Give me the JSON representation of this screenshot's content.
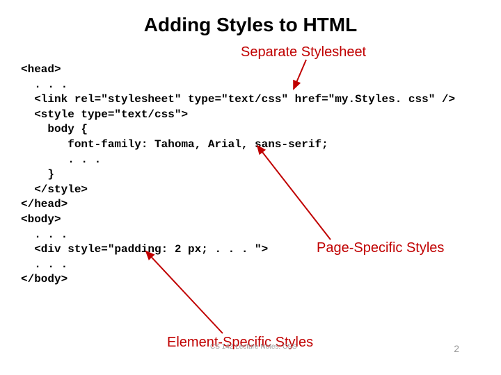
{
  "title": "Adding Styles to HTML",
  "labels": {
    "separate": "Separate Stylesheet",
    "page": "Page-Specific Styles",
    "element": "Element-Specific Styles"
  },
  "code": {
    "l1": "<head>",
    "l2": "  . . .",
    "l3": "  <link rel=\"stylesheet\" type=\"text/css\" href=\"my.Styles. css\" />",
    "l4": "  <style type=\"text/css\">",
    "l5": "    body {",
    "l6": "       font-family: Tahoma, Arial, sans-serif;",
    "l7": "       . . .",
    "l8": "    }",
    "l9": "  </style>",
    "l10": "</head>",
    "l11": "<body>",
    "l12": "  . . .",
    "l13": "  <div style=\"padding: 2 px; . . . \">",
    "l14": "  . . .",
    "l15": "</body>"
  },
  "footer": "CS 142 Lecture Notes: CSS",
  "pageNumber": "2"
}
